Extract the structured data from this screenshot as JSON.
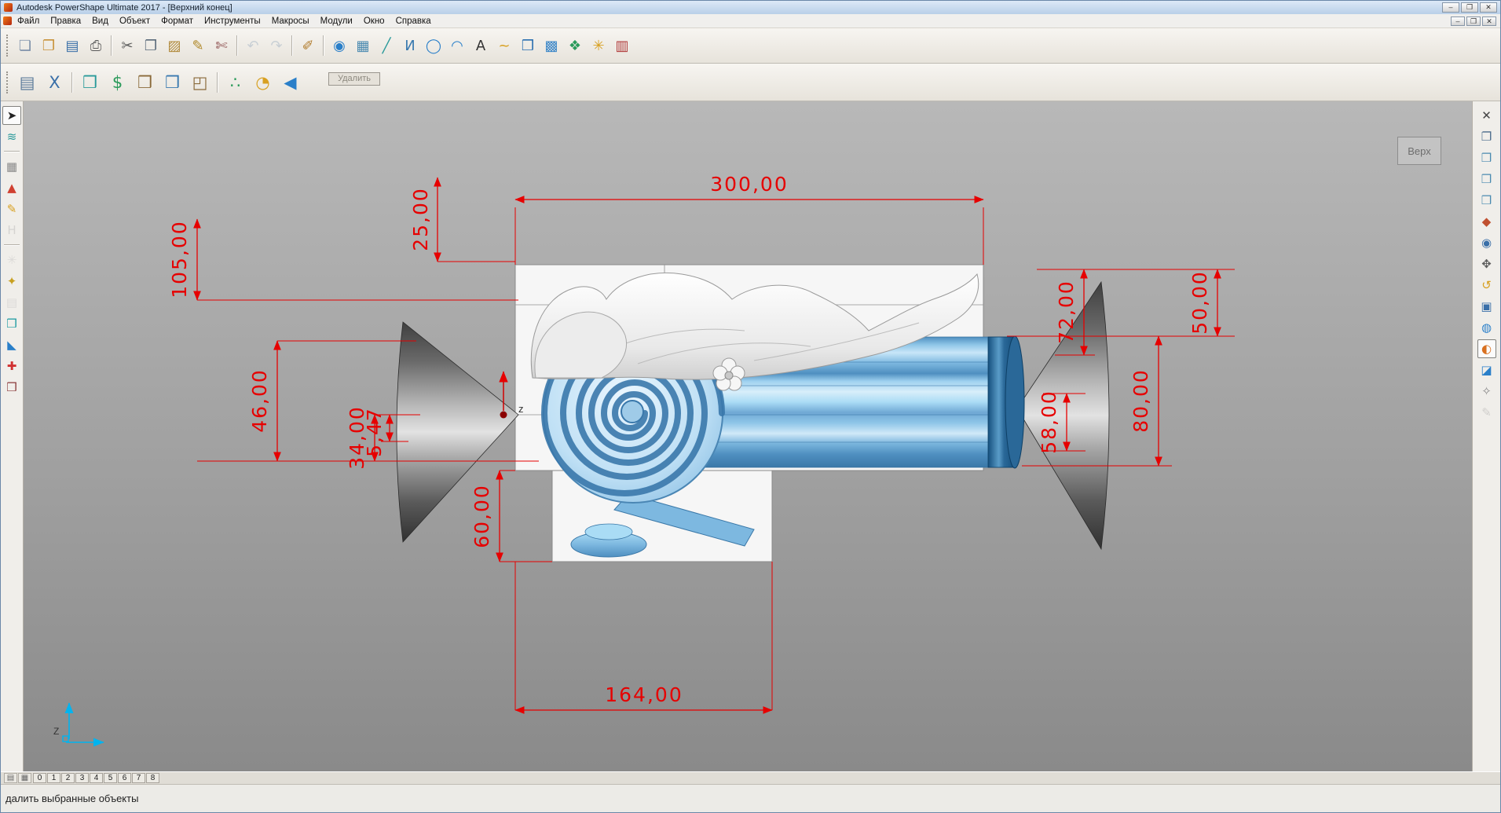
{
  "window": {
    "title": "Autodesk PowerShape Ultimate 2017 - [Верхний конец]",
    "controls": {
      "minimize": "–",
      "maximize": "❐",
      "close": "✕"
    }
  },
  "menu": {
    "items": [
      {
        "name": "menu-file",
        "label": "Файл"
      },
      {
        "name": "menu-edit",
        "label": "Правка"
      },
      {
        "name": "menu-view",
        "label": "Вид"
      },
      {
        "name": "menu-object",
        "label": "Объект"
      },
      {
        "name": "menu-format",
        "label": "Формат"
      },
      {
        "name": "menu-tools",
        "label": "Инструменты"
      },
      {
        "name": "menu-macros",
        "label": "Макросы"
      },
      {
        "name": "menu-modules",
        "label": "Модули"
      },
      {
        "name": "menu-window",
        "label": "Окно"
      },
      {
        "name": "menu-help",
        "label": "Справка"
      }
    ]
  },
  "toolbar_main": {
    "icons": [
      {
        "name": "new-document-icon",
        "glyph": "❏",
        "color": "#7a8ea8"
      },
      {
        "name": "open-icon",
        "glyph": "❐",
        "color": "#c8923a"
      },
      {
        "name": "save-icon",
        "glyph": "▤",
        "color": "#3a6fa8"
      },
      {
        "name": "print-icon",
        "glyph": "⎙",
        "color": "#5a5a5a"
      },
      {
        "sep": true
      },
      {
        "name": "cut-icon",
        "glyph": "✂",
        "color": "#5a5a5a"
      },
      {
        "name": "copy-icon",
        "glyph": "❐",
        "color": "#5a6a7a"
      },
      {
        "name": "paste-icon",
        "glyph": "▨",
        "color": "#b0893a"
      },
      {
        "name": "format-pen-icon",
        "glyph": "✎",
        "color": "#b0892a"
      },
      {
        "name": "delete-object-icon",
        "glyph": "✄",
        "color": "#8a4a4a"
      },
      {
        "sep": true
      },
      {
        "name": "undo-icon",
        "glyph": "↶",
        "color": "#8aa0b8",
        "disabled": true
      },
      {
        "name": "redo-icon",
        "glyph": "↷",
        "color": "#8aa0b8",
        "disabled": true
      },
      {
        "sep": true
      },
      {
        "name": "sketch-icon",
        "glyph": "✐",
        "color": "#b07a2a"
      },
      {
        "sep": true
      },
      {
        "name": "zoom-sphere-icon",
        "glyph": "◉",
        "color": "#2a7fc9"
      },
      {
        "name": "workplane-icon",
        "glyph": "▦",
        "color": "#4a8ab0"
      },
      {
        "name": "line-icon",
        "glyph": "╱",
        "color": "#2a9a9a"
      },
      {
        "name": "polyline-icon",
        "glyph": "И",
        "color": "#3a7ab0"
      },
      {
        "name": "circle-icon",
        "glyph": "◯",
        "color": "#2a7fc9"
      },
      {
        "name": "arc-icon",
        "glyph": "◠",
        "color": "#2a7fc9"
      },
      {
        "name": "text-tool-icon",
        "glyph": "A",
        "color": "#333333"
      },
      {
        "name": "curve-tool-icon",
        "glyph": "~",
        "color": "#d8a020"
      },
      {
        "name": "solid-tool-icon",
        "glyph": "❒",
        "color": "#2a6fb0"
      },
      {
        "name": "surface-tool-icon",
        "glyph": "▩",
        "color": "#3a86c8"
      },
      {
        "name": "feature-tool-icon",
        "glyph": "❖",
        "color": "#2a9a5a"
      },
      {
        "name": "wand-icon",
        "glyph": "✳",
        "color": "#d8a020"
      },
      {
        "name": "toolbox-icon",
        "glyph": "▥",
        "color": "#b03a3a"
      }
    ]
  },
  "toolbar_secondary": {
    "tooltip": "Удалить",
    "icons": [
      {
        "name": "sheets-icon",
        "glyph": "▤",
        "color": "#5a7a9a"
      },
      {
        "name": "x-axis-icon",
        "glyph": "X",
        "color": "#3a6fa8"
      },
      {
        "sep": true
      },
      {
        "name": "cube-arrows-icon",
        "glyph": "❒",
        "color": "#2a9a9a"
      },
      {
        "name": "cube-dollar-icon",
        "glyph": "$",
        "color": "#2a9a5a"
      },
      {
        "name": "cubes-group-icon",
        "glyph": "❒",
        "color": "#8a6a3a"
      },
      {
        "name": "cube-measure-icon",
        "glyph": "❒",
        "color": "#3a7ab0"
      },
      {
        "name": "cubes-count-icon",
        "glyph": "◰",
        "color": "#8a6a3a"
      },
      {
        "sep": true
      },
      {
        "name": "curve-points-icon",
        "glyph": "∴",
        "color": "#2a9a5a"
      },
      {
        "name": "clock-icon",
        "glyph": "◔",
        "color": "#d8a020"
      },
      {
        "name": "back-arrow-icon",
        "glyph": "◀",
        "color": "#2a7fc9"
      }
    ]
  },
  "left_toolbar": {
    "icons": [
      {
        "name": "select-cursor-icon",
        "glyph": "➤",
        "color": "#222222",
        "selected": true
      },
      {
        "name": "wireframe-icon",
        "glyph": "≋",
        "color": "#2a9a9a"
      },
      {
        "sep": true
      },
      {
        "name": "grid-icon",
        "glyph": "▦",
        "color": "#8a8a8a"
      },
      {
        "name": "alarm-icon",
        "glyph": "▲",
        "color": "#d04030"
      },
      {
        "name": "pencil-icon",
        "glyph": "✎",
        "color": "#d8a020"
      },
      {
        "name": "handle-icon",
        "glyph": "H",
        "color": "#aaaaaa",
        "disabled": true
      },
      {
        "sep": true
      },
      {
        "name": "snap-icon",
        "glyph": "✳",
        "color": "#bbbbbb",
        "disabled": true
      },
      {
        "name": "chisel-icon",
        "glyph": "✦",
        "color": "#c8a020"
      },
      {
        "name": "stack-icon",
        "glyph": "▤",
        "color": "#bbbbbb",
        "disabled": true
      },
      {
        "name": "cube-teal-icon",
        "glyph": "❒",
        "color": "#1a9aa0"
      },
      {
        "name": "wedge-icon",
        "glyph": "◣",
        "color": "#2a7fc9"
      },
      {
        "name": "repair-icon",
        "glyph": "✚",
        "color": "#d03030"
      },
      {
        "name": "dark-cube-icon",
        "glyph": "❒",
        "color": "#8a3a3a"
      }
    ]
  },
  "right_toolbar": {
    "icons": [
      {
        "name": "close-pane-icon",
        "glyph": "✕",
        "color": "#444444"
      },
      {
        "name": "window-icon",
        "glyph": "❐",
        "color": "#4a6a8a"
      },
      {
        "name": "view-cube-icon",
        "glyph": "❒",
        "color": "#4a8ab0"
      },
      {
        "name": "view-cube2-icon",
        "glyph": "❒",
        "color": "#4a8ab0"
      },
      {
        "name": "view-cube3-icon",
        "glyph": "❒",
        "color": "#4a8ab0"
      },
      {
        "name": "view-red-icon",
        "glyph": "◆",
        "color": "#c05030"
      },
      {
        "name": "rotate-view-icon",
        "glyph": "◉",
        "color": "#3a6fa8"
      },
      {
        "name": "pan-view-icon",
        "glyph": "✥",
        "color": "#5a5a5a"
      },
      {
        "name": "undo-view-icon",
        "glyph": "↺",
        "color": "#d8a020"
      },
      {
        "name": "zoom-window-icon",
        "glyph": "▣",
        "color": "#3a6fa8"
      },
      {
        "name": "globe-icon",
        "glyph": "◍",
        "color": "#2a7fc9"
      },
      {
        "name": "shaded-view-icon",
        "glyph": "◐",
        "color": "#d87020",
        "selected": true
      },
      {
        "name": "iso-view-icon",
        "glyph": "◪",
        "color": "#2a7fc9"
      },
      {
        "name": "compass-icon",
        "glyph": "✧",
        "color": "#8a8a8a"
      },
      {
        "name": "probe-icon",
        "glyph": "✎",
        "color": "#9a9a9a",
        "disabled": true
      }
    ]
  },
  "viewport": {
    "view_label": "Верх",
    "origin_label": "z",
    "axis_label": "Z"
  },
  "dimensions": {
    "d300": "300,00",
    "d25": "25,00",
    "d105": "105,00",
    "d46": "46,00",
    "d34": "34,00",
    "d547": "5,47",
    "d60": "60,00",
    "d164": "164,00",
    "d72": "72,00",
    "d50": "50,00",
    "d80": "80,00",
    "d58": "58,00"
  },
  "statusbar": {
    "text": "далить выбранные объекты",
    "icons": [
      {
        "name": "status-display-icon",
        "glyph": "▤"
      },
      {
        "name": "status-printer-icon",
        "glyph": "▦"
      }
    ],
    "tabs": [
      "0",
      "1",
      "2",
      "3",
      "4",
      "5",
      "6",
      "7",
      "8"
    ]
  },
  "colors": {
    "dimension_red": "#e60000",
    "model_blue": "#7db8e0",
    "canvas_top": "#b8b8b8",
    "canvas_bottom": "#8a8a8a"
  }
}
